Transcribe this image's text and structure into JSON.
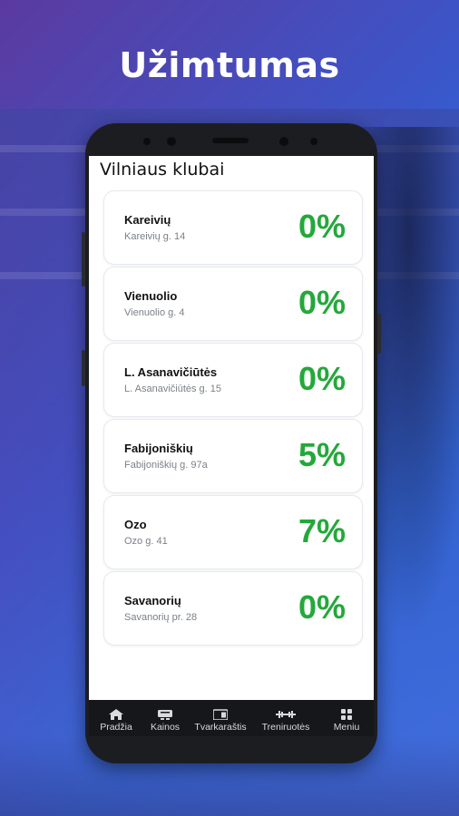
{
  "headline": "Užimtumas",
  "screen_title": "Vilniaus klubai",
  "clubs": [
    {
      "name": "Kareivių",
      "address": "Kareivių g. 14",
      "occupancy": "0%"
    },
    {
      "name": "Vienuolio",
      "address": "Vienuolio g. 4",
      "occupancy": "0%"
    },
    {
      "name": "L. Asanavičiūtės",
      "address": "L. Asanavičiūtės g. 15",
      "occupancy": "0%"
    },
    {
      "name": "Fabijoniškių",
      "address": "Fabijoniškių g. 97a",
      "occupancy": "5%"
    },
    {
      "name": "Ozo",
      "address": "Ozo g. 41",
      "occupancy": "7%"
    },
    {
      "name": "Savanorių",
      "address": "Savanorių pr. 28",
      "occupancy": "0%"
    }
  ],
  "nav": [
    {
      "label": "Pradžia",
      "icon": "home-icon"
    },
    {
      "label": "Kainos",
      "icon": "ticket-icon"
    },
    {
      "label": "Tvarkaraštis",
      "icon": "schedule-icon"
    },
    {
      "label": "Treniruotės",
      "icon": "dumbbell-icon"
    },
    {
      "label": "Meniu",
      "icon": "grid-icon"
    }
  ],
  "colors": {
    "occupancy": "#24a83b",
    "navbar": "#15171a"
  }
}
